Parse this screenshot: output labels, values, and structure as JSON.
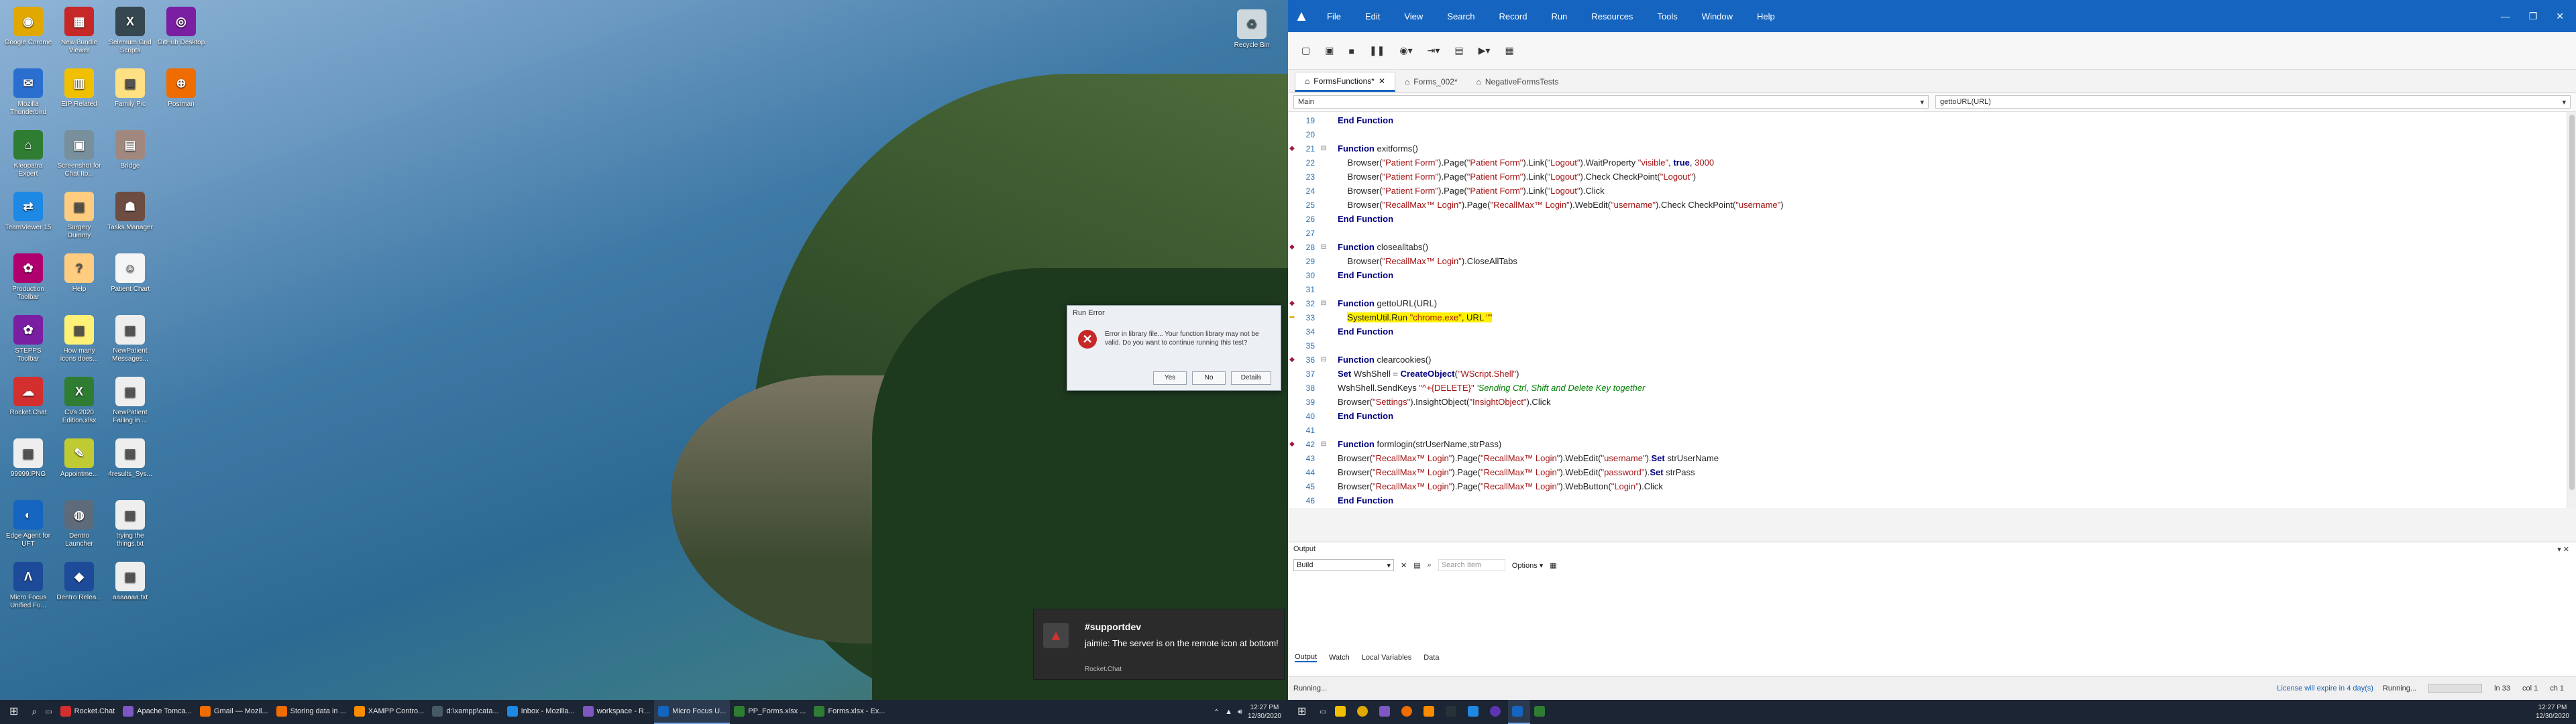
{
  "desktop": {
    "icons": [
      {
        "label": "Google Chrome",
        "color": "#e0a800",
        "glyph": "◉"
      },
      {
        "label": "Mozilla Thunderbird",
        "color": "#2a6fd0",
        "glyph": "✉"
      },
      {
        "label": "Kleopatra Expert",
        "color": "#2e7d32",
        "glyph": "⌂"
      },
      {
        "label": "TeamViewer 15",
        "color": "#1e88e5",
        "glyph": "⇄"
      },
      {
        "label": "Production Toolbar",
        "color": "#b0006e",
        "glyph": "✿"
      },
      {
        "label": "STEPPS Toolbar",
        "color": "#7b1fa2",
        "glyph": "✿"
      },
      {
        "label": "Rocket.Chat",
        "color": "#d32f2f",
        "glyph": "☁"
      },
      {
        "label": "99999.PNG",
        "color": "#eeeeee",
        "glyph": "▤"
      },
      {
        "label": "Edge Agent for UFT",
        "color": "#1565c0",
        "glyph": "◐"
      },
      {
        "label": "Micro Focus Unified Fu...",
        "color": "#1e4a9a",
        "glyph": "Λ"
      },
      {
        "label": "New Bundle Viewer",
        "color": "#c62828",
        "glyph": "▦"
      },
      {
        "label": "EIP Related",
        "color": "#f0c000",
        "glyph": "▥"
      },
      {
        "label": "Screenshot for Chat Ito...",
        "color": "#78909c",
        "glyph": "▣"
      },
      {
        "label": "Surgery Dummy",
        "color": "#ffcc80",
        "glyph": "▤"
      },
      {
        "label": "Help",
        "color": "#ffcc80",
        "glyph": "?"
      },
      {
        "label": "How many icons does...",
        "color": "#fff176",
        "glyph": "▤"
      },
      {
        "label": "CVs 2020 Edition.xlsx",
        "color": "#2e7d32",
        "glyph": "X"
      },
      {
        "label": "Appointme...",
        "color": "#c0ca33",
        "glyph": "✎"
      },
      {
        "label": "Dentro Launcher",
        "color": "#5d6b7a",
        "glyph": "◍"
      },
      {
        "label": "Dentro Relea...",
        "color": "#1e4a9a",
        "glyph": "◆"
      },
      {
        "label": "Selenium Grid Scripts",
        "color": "#37474f",
        "glyph": "X"
      },
      {
        "label": "Family Pic",
        "color": "#ffe082",
        "glyph": "▣"
      },
      {
        "label": "Bridge",
        "color": "#a1887f",
        "glyph": "▤"
      },
      {
        "label": "Tasks Manager",
        "color": "#6d4c41",
        "glyph": "☗"
      },
      {
        "label": "Patient Chart",
        "color": "#f5f5f5",
        "glyph": "☺"
      },
      {
        "label": "NewPatient Messages...",
        "color": "#eeeeee",
        "glyph": "▤"
      },
      {
        "label": "NewPatient Failing in ...",
        "color": "#eeeeee",
        "glyph": "▤"
      },
      {
        "label": "4results_Sys...",
        "color": "#eeeeee",
        "glyph": "▤"
      },
      {
        "label": "trying the things.txt",
        "color": "#eeeeee",
        "glyph": "▤"
      },
      {
        "label": "aaaaaaa.txt",
        "color": "#eeeeee",
        "glyph": "▤"
      },
      {
        "label": "GitHub Desktop",
        "color": "#7b1fa2",
        "glyph": "◎"
      },
      {
        "label": "Postman",
        "color": "#ef6c00",
        "glyph": "⊕"
      }
    ],
    "recycle": "Recycle Bin"
  },
  "dialog": {
    "title": "Run Error",
    "message": "Error in library file... Your function library may not be valid. Do you want to continue running this test?",
    "yes": "Yes",
    "no": "No",
    "details": "Details"
  },
  "toast": {
    "channel": "#supportdev",
    "message": "jaimie: The server is on the remote icon at bottom!",
    "app": "Rocket.Chat"
  },
  "taskbar_left": {
    "items": [
      {
        "label": "Rocket.Chat",
        "color": "#d32f2f"
      },
      {
        "label": "Apache Tomca...",
        "color": "#7e57c2"
      },
      {
        "label": "Gmail — Mozil...",
        "color": "#ef6c00"
      },
      {
        "label": "Storing data in ...",
        "color": "#ef6c00"
      },
      {
        "label": "XAMPP Contro...",
        "color": "#fb8c00"
      },
      {
        "label": "d:\\xampp\\cata...",
        "color": "#455a64"
      },
      {
        "label": "Inbox - Mozilla...",
        "color": "#1e88e5"
      },
      {
        "label": "workspace - R...",
        "color": "#7e57c2"
      },
      {
        "label": "Micro Focus U...",
        "color": "#1565c0"
      },
      {
        "label": "PP_Forms.xlsx ...",
        "color": "#2e7d32"
      },
      {
        "label": "Forms.xlsx - Ex...",
        "color": "#2e7d32"
      }
    ],
    "time": "12:27 PM",
    "date": "12/30/2020"
  },
  "taskbar_right": {
    "time": "12:27 PM",
    "date": "12/30/2020"
  },
  "ide": {
    "menu": [
      "File",
      "Edit",
      "View",
      "Search",
      "Record",
      "Run",
      "Resources",
      "Tools",
      "Window",
      "Help"
    ],
    "toolbar_icons": [
      "new-file-icon",
      "open-icon",
      "stop-icon",
      "pause-icon",
      "record-icon",
      "step-icon",
      "save-icon",
      "run-icon",
      "grid-icon"
    ],
    "tabs": [
      {
        "label": "FormsFunctions*",
        "active": true
      },
      {
        "label": "Forms_002*",
        "active": false
      },
      {
        "label": "NegativeFormsTests",
        "active": false
      }
    ],
    "scope_left": "Main",
    "scope_right": "gettoURL(URL)",
    "lines": [
      {
        "n": "19",
        "html": "<span class='kw'>End Function</span>",
        "bp": false
      },
      {
        "n": "20",
        "html": "",
        "bp": false
      },
      {
        "n": "21",
        "html": "<span class='kw'>Function</span> exitforms()",
        "bp": true
      },
      {
        "n": "22",
        "html": "    Browser(<span class='str'>\"Patient Form\"</span>).Page(<span class='str'>\"Patient Form\"</span>).Link(<span class='str'>\"Logout\"</span>).WaitProperty <span class='str'>\"visible\"</span>, <span class='kw'>true</span>, <span class='str'>3000</span>",
        "bp": false
      },
      {
        "n": "23",
        "html": "    Browser(<span class='str'>\"Patient Form\"</span>).Page(<span class='str'>\"Patient Form\"</span>).Link(<span class='str'>\"Logout\"</span>).Check CheckPoint(<span class='str'>\"Logout\"</span>)",
        "bp": false
      },
      {
        "n": "24",
        "html": "    Browser(<span class='str'>\"Patient Form\"</span>).Page(<span class='str'>\"Patient Form\"</span>).Link(<span class='str'>\"Logout\"</span>).Click",
        "bp": false
      },
      {
        "n": "25",
        "html": "    Browser(<span class='str'>\"RecallMax™ Login\"</span>).Page(<span class='str'>\"RecallMax™ Login\"</span>).WebEdit(<span class='str'>\"username\"</span>).Check CheckPoint(<span class='str'>\"username\"</span>)",
        "bp": false
      },
      {
        "n": "26",
        "html": "<span class='kw'>End Function</span>",
        "bp": false
      },
      {
        "n": "27",
        "html": "",
        "bp": false
      },
      {
        "n": "28",
        "html": "<span class='kw'>Function</span> closealltabs()",
        "bp": true
      },
      {
        "n": "29",
        "html": "    Browser(<span class='str'>\"RecallMax™ Login\"</span>).CloseAllTabs",
        "bp": false
      },
      {
        "n": "30",
        "html": "<span class='kw'>End Function</span>",
        "bp": false
      },
      {
        "n": "31",
        "html": "",
        "bp": false
      },
      {
        "n": "32",
        "html": "<span class='kw'>Function</span> gettoURL(URL)",
        "bp": true
      },
      {
        "n": "33",
        "html": "    <span class='hl'>SystemUtil.Run <span class='str'>\"chrome.exe\"</span>, URL <span class='str'>\"\"</span></span>",
        "bp": false,
        "arrow": true
      },
      {
        "n": "34",
        "html": "<span class='kw'>End Function</span>",
        "bp": false
      },
      {
        "n": "35",
        "html": "",
        "bp": false
      },
      {
        "n": "36",
        "html": "<span class='kw'>Function</span> clearcookies()",
        "bp": true
      },
      {
        "n": "37",
        "html": "<span class='kw'>Set</span> WshShell = <span class='kw'>CreateObject</span>(<span class='str'>\"WScript.Shell\"</span>)",
        "bp": false
      },
      {
        "n": "38",
        "html": "WshShell.SendKeys <span class='str'>\"^+{DELETE}\"</span> <span class='cmt'>'Sending Ctrl, Shift and Delete Key together</span>",
        "bp": false
      },
      {
        "n": "39",
        "html": "Browser(<span class='str'>\"Settings\"</span>).InsightObject(<span class='str'>\"InsightObject\"</span>).Click",
        "bp": false
      },
      {
        "n": "40",
        "html": "<span class='kw'>End Function</span>",
        "bp": false
      },
      {
        "n": "41",
        "html": "",
        "bp": false
      },
      {
        "n": "42",
        "html": "<span class='kw'>Function</span> formlogin(strUserName,strPass)",
        "bp": true
      },
      {
        "n": "43",
        "html": "Browser(<span class='str'>\"RecallMax™ Login\"</span>).Page(<span class='str'>\"RecallMax™ Login\"</span>).WebEdit(<span class='str'>\"username\"</span>).<span class='kw'>Set</span> strUserName",
        "bp": false
      },
      {
        "n": "44",
        "html": "Browser(<span class='str'>\"RecallMax™ Login\"</span>).Page(<span class='str'>\"RecallMax™ Login\"</span>).WebEdit(<span class='str'>\"password\"</span>).<span class='kw'>Set</span> strPass",
        "bp": false
      },
      {
        "n": "45",
        "html": "Browser(<span class='str'>\"RecallMax™ Login\"</span>).Page(<span class='str'>\"RecallMax™ Login\"</span>).WebButton(<span class='str'>\"Login\"</span>).Click",
        "bp": false
      },
      {
        "n": "46",
        "html": "<span class='kw'>End Function</span>",
        "bp": false
      }
    ],
    "output": {
      "title": "Output",
      "select": "Build",
      "search_placeholder": "Search Item",
      "options": "Options",
      "tabs": [
        "Output",
        "Watch",
        "Local Variables",
        "Data"
      ]
    },
    "status": {
      "left": "Running...",
      "license": "License will expire in 4 day(s)",
      "running": "Running...",
      "ln": "ln 33",
      "col": "col 1",
      "ch": "ch 1"
    }
  }
}
